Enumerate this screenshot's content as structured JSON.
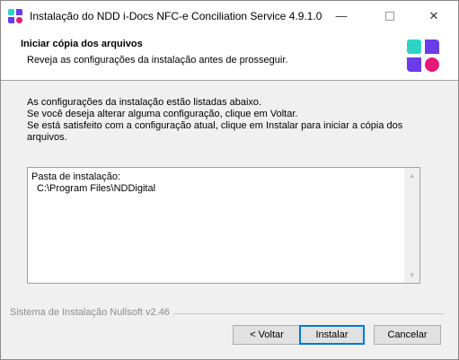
{
  "window": {
    "title": "Instalação do NDD i-Docs NFC-e Conciliation Service 4.9.1.0",
    "minimize_glyph": "—",
    "close_glyph": "✕"
  },
  "header": {
    "title": "Iniciar cópia dos arquivos",
    "subtitle": "Reveja as configurações da instalação antes de prosseguir."
  },
  "body": {
    "lines": [
      "As configurações da instalação estão listadas abaixo.",
      "Se você deseja alterar alguma configuração, clique em Voltar.",
      "Se está satisfeito com a configuração atual, clique em Instalar para iniciar a cópia dos",
      "arquivos."
    ]
  },
  "summary": {
    "label": "Pasta de instalação:",
    "value": "C:\\Program Files\\NDDigital"
  },
  "footer": {
    "brand": "Sistema de Instalação Nullsoft v2.46"
  },
  "buttons": {
    "back": "< Voltar",
    "install": "Instalar",
    "cancel": "Cancelar"
  },
  "colors": {
    "logo_teal": "#2ed3c6",
    "logo_purple": "#6a3de8",
    "logo_pink": "#e6197a",
    "focus_border": "#0078d7"
  },
  "icons": {
    "app": "ndd-logo-icon",
    "header": "ndd-logo-icon"
  }
}
